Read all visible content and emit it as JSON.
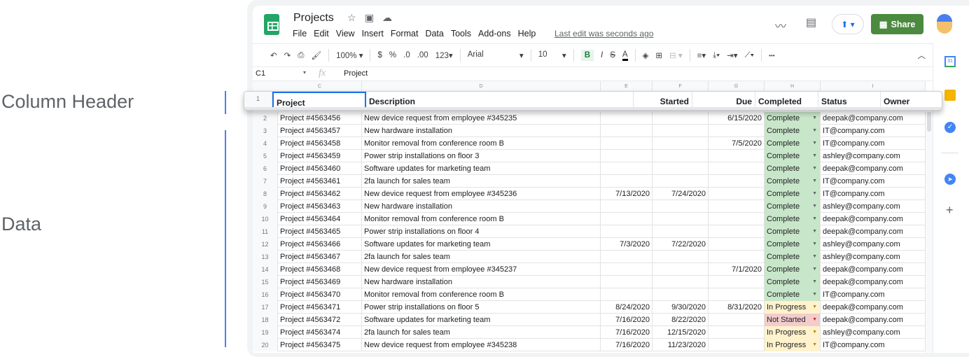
{
  "annotations": {
    "column_header": "Column Header",
    "data": "Data"
  },
  "app": {
    "title": "Projects",
    "menu": [
      "File",
      "Edit",
      "View",
      "Insert",
      "Format",
      "Data",
      "Tools",
      "Add-ons",
      "Help"
    ],
    "last_edit": "Last edit was seconds ago",
    "share": "Share",
    "share_color": "#4b8a3f"
  },
  "toolbar": {
    "zoom": "100%",
    "currency": "$",
    "percent": "%",
    "dec_less": ".0",
    "dec_more": ".00",
    "format": "123",
    "font": "Arial",
    "size": "10",
    "bold": "B",
    "italic": "I",
    "strike": "S",
    "text_color": "A",
    "more": "•••"
  },
  "formula": {
    "cell_ref": "C1",
    "fx": "fx",
    "value": "Project"
  },
  "columns": [
    "C",
    "D",
    "E",
    "F",
    "G",
    "H",
    "I"
  ],
  "header": {
    "row_number": "1",
    "cells": [
      "Project",
      "Description",
      "Started",
      "Due",
      "Completed",
      "Status",
      "Owner"
    ]
  },
  "status_colors": {
    "Complete": "#c8e6c9",
    "In Progress": "#fff2cc",
    "Not Started": "#f4cccc"
  },
  "rows": [
    [
      "2",
      "Project #4563456",
      "New device request from employee #345235",
      "",
      "",
      "6/15/2020",
      "Complete",
      "deepak@company.com"
    ],
    [
      "3",
      "Project #4563457",
      "New hardware installation",
      "",
      "",
      "",
      "Complete",
      "IT@company.com"
    ],
    [
      "4",
      "Project #4563458",
      "Monitor removal from conference room B",
      "",
      "",
      "7/5/2020",
      "Complete",
      "IT@company.com"
    ],
    [
      "5",
      "Project #4563459",
      "Power strip installations on floor 3",
      "",
      "",
      "",
      "Complete",
      "ashley@company.com"
    ],
    [
      "6",
      "Project #4563460",
      "Software updates for marketing team",
      "",
      "",
      "",
      "Complete",
      "deepak@company.com"
    ],
    [
      "7",
      "Project #4563461",
      "2fa launch for sales team",
      "",
      "",
      "",
      "Complete",
      "IT@company.com"
    ],
    [
      "8",
      "Project #4563462",
      "New device request from employee #345236",
      "7/13/2020",
      "7/24/2020",
      "",
      "Complete",
      "IT@company.com"
    ],
    [
      "9",
      "Project #4563463",
      "New hardware installation",
      "",
      "",
      "",
      "Complete",
      "ashley@company.com"
    ],
    [
      "10",
      "Project #4563464",
      "Monitor removal from conference room B",
      "",
      "",
      "",
      "Complete",
      "deepak@company.com"
    ],
    [
      "11",
      "Project #4563465",
      "Power strip installations on floor 4",
      "",
      "",
      "",
      "Complete",
      "deepak@company.com"
    ],
    [
      "12",
      "Project #4563466",
      "Software updates for marketing team",
      "7/3/2020",
      "7/22/2020",
      "",
      "Complete",
      "ashley@company.com"
    ],
    [
      "13",
      "Project #4563467",
      "2fa launch for sales team",
      "",
      "",
      "",
      "Complete",
      "ashley@company.com"
    ],
    [
      "14",
      "Project #4563468",
      "New device request from employee #345237",
      "",
      "",
      "7/1/2020",
      "Complete",
      "deepak@company.com"
    ],
    [
      "15",
      "Project #4563469",
      "New hardware installation",
      "",
      "",
      "",
      "Complete",
      "deepak@company.com"
    ],
    [
      "16",
      "Project #4563470",
      "Monitor removal from conference room B",
      "",
      "",
      "",
      "Complete",
      "IT@company.com"
    ],
    [
      "17",
      "Project #4563471",
      "Power strip installations on floor 5",
      "8/24/2020",
      "9/30/2020",
      "8/31/2020",
      "In Progress",
      "deepak@company.com"
    ],
    [
      "18",
      "Project #4563472",
      "Software updates for marketing team",
      "7/16/2020",
      "8/22/2020",
      "",
      "Not Started",
      "deepak@company.com"
    ],
    [
      "19",
      "Project #4563474",
      "2fa launch for sales team",
      "7/16/2020",
      "12/15/2020",
      "",
      "In Progress",
      "ashley@company.com"
    ],
    [
      "20",
      "Project #4563475",
      "New device request from employee #345238",
      "7/16/2020",
      "11/23/2020",
      "",
      "In Progress",
      "IT@company.com"
    ]
  ]
}
